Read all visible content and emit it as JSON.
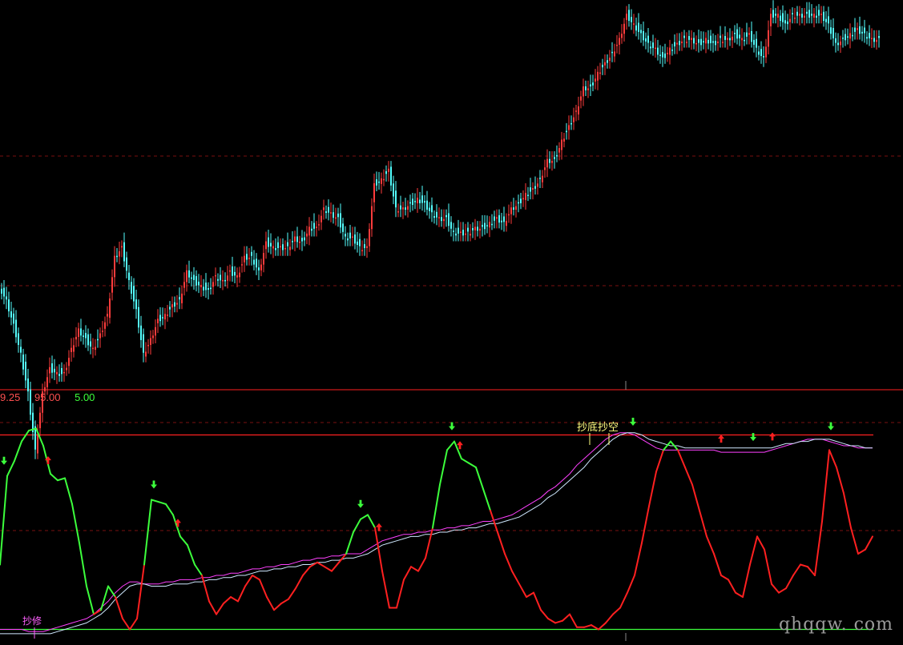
{
  "readout": {
    "v1": "9.25",
    "v2": "95.00",
    "v3": "5.00",
    "colors": {
      "v1": "#ff5050",
      "v2": "#ff5050",
      "v3": "#3cff3c"
    }
  },
  "labels": {
    "top_label": "抄底抄空",
    "bottom_label": "抄修"
  },
  "watermark": "qhqqw. com",
  "colors": {
    "bg": "#000000",
    "candle_up": "#ff3c3c",
    "candle_down": "#54ffff",
    "dashed_grid": "#7a1010",
    "panel_separator": "#ff2020",
    "upper_threshold": "#ff2020",
    "lower_threshold": "#3cff3c",
    "osc_above": "#3cff3c",
    "osc_below": "#ff2020",
    "avg_magenta": "#ff40ff",
    "avg_white": "#cfe8ff",
    "arrow_up": "#ff2020",
    "arrow_down": "#3cff3c",
    "label_yellow": "#ffff80",
    "label_magenta": "#ff60ff"
  },
  "chart_data": [
    {
      "type": "candlestick",
      "x": [
        0,
        9,
        18,
        27,
        36,
        45,
        54,
        63,
        72,
        81,
        90,
        99,
        108,
        117,
        126,
        135,
        144,
        153,
        162,
        171,
        180,
        189,
        198,
        207,
        216,
        225,
        234,
        243,
        252,
        261,
        270,
        279,
        288,
        297,
        306,
        315,
        324,
        333,
        342,
        351,
        360,
        369,
        378,
        387,
        396,
        405,
        414,
        423,
        432,
        441,
        450,
        459,
        468,
        477,
        486,
        495,
        504,
        513,
        522,
        531,
        540,
        549,
        558,
        567,
        576,
        585,
        594,
        603,
        612,
        621,
        630,
        639,
        648,
        657,
        666,
        675,
        684,
        693,
        702,
        711,
        720,
        729,
        738,
        747,
        756,
        765,
        774,
        783,
        792,
        801,
        810,
        819,
        828,
        837,
        846,
        855,
        864,
        873,
        882,
        891,
        900,
        909,
        918,
        927,
        936,
        945,
        954,
        963,
        972,
        981,
        990,
        999,
        1008,
        1017,
        1026,
        1035,
        1044,
        1053,
        1062,
        1071,
        1080,
        1089
      ],
      "y": [
        0.2,
        0.17,
        0.12,
        0.06,
        -0.02,
        -0.14,
        -0.02,
        0.03,
        0.02,
        0.02,
        0.07,
        0.11,
        0.09,
        0.07,
        0.1,
        0.14,
        0.26,
        0.28,
        0.21,
        0.15,
        0.06,
        0.09,
        0.13,
        0.14,
        0.16,
        0.17,
        0.23,
        0.21,
        0.2,
        0.19,
        0.22,
        0.21,
        0.23,
        0.22,
        0.26,
        0.26,
        0.23,
        0.29,
        0.28,
        0.28,
        0.28,
        0.3,
        0.29,
        0.32,
        0.32,
        0.36,
        0.35,
        0.34,
        0.3,
        0.3,
        0.28,
        0.28,
        0.41,
        0.42,
        0.44,
        0.36,
        0.36,
        0.37,
        0.38,
        0.37,
        0.35,
        0.34,
        0.34,
        0.31,
        0.31,
        0.31,
        0.32,
        0.32,
        0.33,
        0.34,
        0.33,
        0.36,
        0.37,
        0.39,
        0.4,
        0.42,
        0.46,
        0.46,
        0.5,
        0.53,
        0.56,
        0.61,
        0.61,
        0.64,
        0.66,
        0.68,
        0.71,
        0.76,
        0.74,
        0.72,
        0.7,
        0.69,
        0.67,
        0.69,
        0.7,
        0.71,
        0.71,
        0.7,
        0.71,
        0.7,
        0.71,
        0.71,
        0.72,
        0.71,
        0.72,
        0.69,
        0.67,
        0.76,
        0.76,
        0.74,
        0.76,
        0.76,
        0.76,
        0.76,
        0.76,
        0.74,
        0.7,
        0.71,
        0.72,
        0.73,
        0.72,
        0.71
      ],
      "xlabel": "",
      "ylabel": ""
    },
    {
      "type": "line",
      "x": [
        0,
        9,
        18,
        27,
        36,
        45,
        54,
        63,
        72,
        81,
        90,
        99,
        108,
        117,
        126,
        135,
        144,
        153,
        162,
        171,
        180,
        189,
        198,
        207,
        216,
        225,
        234,
        243,
        252,
        261,
        270,
        279,
        288,
        297,
        306,
        315,
        324,
        333,
        342,
        351,
        360,
        369,
        378,
        387,
        396,
        405,
        414,
        423,
        432,
        441,
        450,
        459,
        468,
        477,
        486,
        495,
        504,
        513,
        522,
        531,
        540,
        549,
        558,
        567,
        576,
        585,
        594,
        603,
        612,
        621,
        630,
        639,
        648,
        657,
        666,
        675,
        684,
        693,
        702,
        711,
        720,
        729,
        738,
        747,
        756,
        765,
        774,
        783,
        792,
        801,
        810,
        819,
        828,
        837,
        846,
        855,
        864,
        873,
        882,
        891,
        900,
        909,
        918,
        927,
        936,
        945,
        954,
        963,
        972,
        981,
        990,
        999,
        1008,
        1017,
        1026,
        1035,
        1044,
        1053,
        1062,
        1071,
        1080,
        1089
      ],
      "ylim": [
        0,
        100
      ],
      "reference_lines": [
        95,
        5
      ],
      "series": [
        {
          "values": [
            35,
            76,
            83,
            92,
            97,
            98,
            90,
            77,
            74,
            75,
            63,
            45,
            25,
            12,
            14,
            25,
            20,
            10,
            5,
            10,
            35,
            65,
            64,
            63,
            58,
            48,
            44,
            35,
            30,
            18,
            12,
            17,
            20,
            18,
            25,
            30,
            28,
            20,
            14,
            17,
            19,
            24,
            30,
            34,
            36,
            34,
            32,
            36,
            40,
            50,
            56,
            58,
            52,
            32,
            15,
            15,
            28,
            34,
            32,
            38,
            52,
            72,
            88,
            92,
            84,
            82,
            80,
            70,
            60,
            50,
            40,
            32,
            26,
            20,
            22,
            14,
            10,
            8,
            9,
            12,
            6,
            6,
            7,
            5,
            8,
            12,
            15,
            22,
            30,
            45,
            62,
            78,
            88,
            92,
            88,
            80,
            72,
            60,
            48,
            40,
            30,
            28,
            22,
            20,
            35,
            48,
            42,
            26,
            22,
            24,
            30,
            35,
            34,
            30,
            55,
            88,
            80,
            68,
            52,
            40,
            42,
            48
          ]
        },
        {
          "values": [
            5,
            5,
            5,
            5,
            4,
            4,
            4,
            5,
            6,
            7,
            8,
            9,
            10,
            12,
            15,
            18,
            22,
            25,
            27,
            27,
            26,
            26,
            26,
            27,
            27,
            28,
            28,
            28,
            29,
            29,
            30,
            30,
            31,
            31,
            32,
            33,
            33,
            34,
            34,
            35,
            35,
            36,
            37,
            37,
            38,
            38,
            39,
            39,
            40,
            40,
            40,
            42,
            44,
            46,
            47,
            48,
            49,
            49,
            50,
            50,
            51,
            51,
            52,
            52,
            53,
            53,
            54,
            55,
            55,
            56,
            57,
            58,
            60,
            62,
            64,
            66,
            69,
            71,
            74,
            77,
            81,
            84,
            87,
            90,
            93,
            95,
            96,
            96,
            95,
            93,
            91,
            89,
            88,
            88,
            88,
            88,
            88,
            88,
            88,
            88,
            87,
            87,
            87,
            87,
            87,
            87,
            87,
            88,
            89,
            90,
            91,
            92,
            93,
            93,
            93,
            92,
            91,
            90,
            90,
            89,
            89,
            89
          ]
        },
        {
          "values": [
            3,
            3,
            3,
            3,
            3,
            3,
            3,
            3,
            4,
            5,
            6,
            7,
            8,
            10,
            12,
            15,
            19,
            22,
            25,
            26,
            26,
            25,
            25,
            25,
            26,
            26,
            26,
            27,
            27,
            28,
            28,
            29,
            29,
            30,
            30,
            31,
            32,
            32,
            33,
            33,
            34,
            34,
            35,
            35,
            36,
            36,
            37,
            37,
            38,
            38,
            39,
            40,
            42,
            44,
            45,
            46,
            47,
            48,
            48,
            49,
            49,
            50,
            50,
            51,
            51,
            52,
            52,
            53,
            54,
            54,
            55,
            56,
            57,
            59,
            61,
            63,
            66,
            68,
            71,
            74,
            77,
            80,
            84,
            87,
            90,
            93,
            95,
            96,
            96,
            95,
            93,
            92,
            91,
            90,
            90,
            89,
            89,
            89,
            89,
            89,
            89,
            89,
            89,
            89,
            89,
            89,
            89,
            89,
            90,
            91,
            91,
            92,
            92,
            93,
            93,
            93,
            92,
            91,
            90,
            90,
            89,
            89
          ]
        }
      ],
      "arrows_up": [
        60,
        222,
        473,
        574,
        900,
        964
      ],
      "arrows_down": [
        5,
        192,
        450,
        564,
        790,
        940,
        1037
      ],
      "xlabel": "",
      "ylabel": ""
    }
  ]
}
